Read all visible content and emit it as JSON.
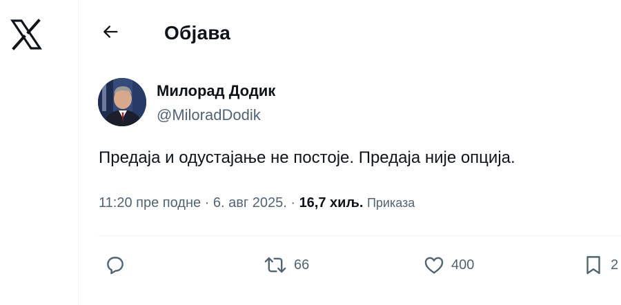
{
  "header": {
    "logo_icon": "x-logo-icon",
    "back_icon": "arrow-left-icon",
    "title": "Објава"
  },
  "author": {
    "name": "Милорад Додик",
    "handle": "@MiloradDodik"
  },
  "tweet": {
    "text": "Предаја и одустајање не постоје. Предаја није опција.",
    "time": "11:20 пре подне",
    "date": "6. авг 2025.",
    "views_count": "16,7 хиљ.",
    "views_label": "Приказа"
  },
  "actions": {
    "reply_icon": "reply-icon",
    "retweet_icon": "retweet-icon",
    "retweet_count": "66",
    "like_icon": "heart-icon",
    "like_count": "400",
    "bookmark_icon": "bookmark-icon",
    "bookmark_count": "2"
  },
  "colors": {
    "text": "#0f1419",
    "secondary": "#536471",
    "divider": "#eff3f4"
  }
}
